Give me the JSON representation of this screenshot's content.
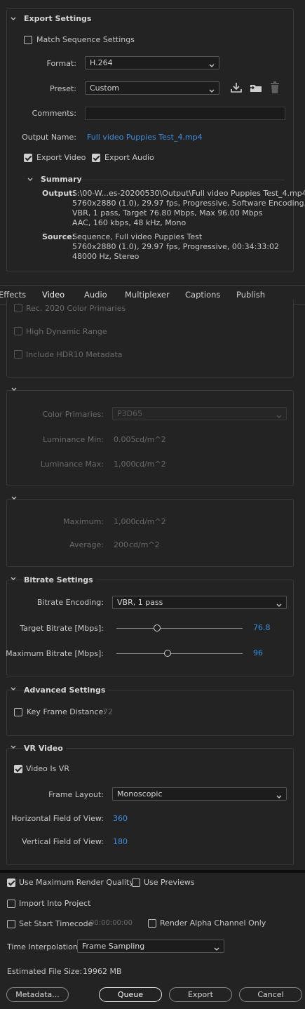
{
  "export_settings": {
    "title": "Export Settings",
    "match_sequence_label": "Match Sequence Settings",
    "format_label": "Format:",
    "format_value": "H.264",
    "preset_label": "Preset:",
    "preset_value": "Custom",
    "comments_label": "Comments:",
    "comments_value": "",
    "output_name_label": "Output Name:",
    "output_name_value": "Full video Puppies Test_4.mp4",
    "export_video_label": "Export Video",
    "export_audio_label": "Export Audio"
  },
  "summary": {
    "title": "Summary",
    "output_label": "Output:",
    "output_lines": [
      "S:\\00-W...es-20200530\\Output\\Full video Puppies Test_4.mp4",
      "5760x2880 (1.0), 29.97 fps, Progressive, Software Encoding, ...",
      "VBR, 1 pass, Target 76.80 Mbps, Max 96.00 Mbps",
      "AAC, 160 kbps, 48 kHz, Mono"
    ],
    "source_label": "Source:",
    "source_lines": [
      "Sequence, Full video Puppies Test",
      "5760x2880 (1.0), 29.97 fps, Progressive, 00:34:33:02",
      "48000 Hz, Stereo"
    ]
  },
  "tabs": [
    "Effects",
    "Video",
    "Audio",
    "Multiplexer",
    "Captions",
    "Publish"
  ],
  "active_tab": "Video",
  "hdr": {
    "rec2020_label": "Rec. 2020 Color Primaries",
    "high_dynamic_range_label": "High Dynamic Range",
    "include_hdr10_label": "Include HDR10 Metadata"
  },
  "color_panel": {
    "color_primaries_label": "Color Primaries:",
    "color_primaries_value": "P3D65",
    "luminance_min_label": "Luminance Min:",
    "luminance_min_value": "0.005",
    "luminance_min_unit": "cd/m^2",
    "luminance_max_label": "Luminance Max:",
    "luminance_max_value": "1,000",
    "luminance_max_unit": "cd/m^2"
  },
  "light_panel": {
    "maximum_label": "Maximum:",
    "maximum_value": "1,000",
    "maximum_unit": "cd/m^2",
    "average_label": "Average:",
    "average_value": "200",
    "average_unit": "cd/m^2"
  },
  "bitrate": {
    "title": "Bitrate Settings",
    "encoding_label": "Bitrate Encoding:",
    "encoding_value": "VBR, 1 pass",
    "target_label": "Target Bitrate [Mbps]:",
    "target_value": "76.8",
    "max_label": "Maximum Bitrate [Mbps]:",
    "max_value": "96"
  },
  "advanced": {
    "title": "Advanced Settings",
    "key_frame_label": "Key Frame Distance:",
    "key_frame_value": "72"
  },
  "vr": {
    "title": "VR Video",
    "video_is_vr_label": "Video Is VR",
    "frame_layout_label": "Frame Layout:",
    "frame_layout_value": "Monoscopic",
    "hfov_label": "Horizontal Field of View:",
    "hfov_value": "360",
    "vfov_label": "Vertical Field of View:",
    "vfov_value": "180"
  },
  "bottom": {
    "max_render_quality_label": "Use Maximum Render Quality",
    "use_previews_label": "Use Previews",
    "import_into_project_label": "Import Into Project",
    "set_start_timecode_label": "Set Start Timecode",
    "start_timecode_value": "00:00:00:00",
    "render_alpha_label": "Render Alpha Channel Only",
    "time_interp_label": "Time Interpolation:",
    "time_interp_value": "Frame Sampling",
    "est_size_label": "Estimated File Size:",
    "est_size_value": "19962 MB",
    "metadata_button": "Metadata...",
    "queue_button": "Queue",
    "export_button": "Export",
    "cancel_button": "Cancel"
  },
  "colors": {
    "background": "#232323",
    "accent_blue": "#3f8ee0",
    "panel_border": "#3a3a3a"
  }
}
